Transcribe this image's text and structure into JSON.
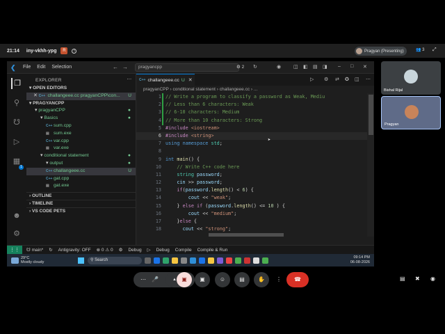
{
  "meet": {
    "time": "21:14",
    "code": "iny-vkhh-ypg",
    "badge": "R",
    "info_icon": "i",
    "presenter": "Pragyan (Presenting)",
    "participant_count": "3"
  },
  "vscode": {
    "menu": [
      "File",
      "Edit",
      "Selection"
    ],
    "command_center": "pragyancpp",
    "copilot_count": "2",
    "explorer_title": "EXPLORER",
    "open_editors_label": "OPEN EDITORS",
    "open_editor_file": "challangeee.cc pragyanCPP\\con...",
    "open_editor_status": "U",
    "root_folder": "PRAGYANCPP",
    "tree": [
      {
        "label": "pragyanCPP",
        "kind": "folder",
        "depth": 1
      },
      {
        "label": "Basics",
        "kind": "folder",
        "depth": 2
      },
      {
        "label": "sum.cpp",
        "kind": "file",
        "depth": 3
      },
      {
        "label": "sum.exe",
        "kind": "exe",
        "depth": 3
      },
      {
        "label": "var.cpp",
        "kind": "file",
        "depth": 3
      },
      {
        "label": "var.exe",
        "kind": "exe",
        "depth": 3
      },
      {
        "label": "conditional statement",
        "kind": "folder",
        "depth": 2
      },
      {
        "label": "output",
        "kind": "folder",
        "depth": 3
      },
      {
        "label": "challangeee.cc",
        "kind": "file",
        "depth": 3,
        "status": "U"
      },
      {
        "label": "gat.cpp",
        "kind": "file",
        "depth": 3
      },
      {
        "label": "gat.exe",
        "kind": "exe",
        "depth": 3
      }
    ],
    "outline_label": "OUTLINE",
    "timeline_label": "TIMELINE",
    "code_pets_label": "VS CODE PETS",
    "tab_name": "challangeee.cc",
    "tab_status": "U",
    "breadcrumb": "pragyanCPP › conditional statement › challangeee.cc › ...",
    "code_lines": [
      {
        "n": "1",
        "html": "<span class='cm'>// Write a program to classify a password as Weak, Mediu</span>"
      },
      {
        "n": "2",
        "html": "<span class='cm'>// Less than 6 characters: Weak</span>"
      },
      {
        "n": "3",
        "html": "<span class='cm'>// 6-10 characters: Medium</span>"
      },
      {
        "n": "4",
        "html": "<span class='cm'>// More than 10 characters: Strong</span>"
      },
      {
        "n": "5",
        "html": "<span class='pp'>#include</span> <span class='st'>&lt;iostream&gt;</span>"
      },
      {
        "n": "6",
        "html": "<span class='pp'>#include</span> <span class='st'>&lt;string&gt;</span>",
        "current": true
      },
      {
        "n": "7",
        "html": "<span class='kw'>using</span> <span class='kw'>namespace</span> <span class='ty'>std</span>;"
      },
      {
        "n": "8",
        "html": ""
      },
      {
        "n": "9",
        "html": "<span class='kw'>int</span> <span class='fn'>main</span>() {"
      },
      {
        "n": "10",
        "html": "    <span class='cm'>// Write C++ code here</span>"
      },
      {
        "n": "11",
        "html": "    <span class='ty'>string</span> <span class='va'>password</span>;"
      },
      {
        "n": "12",
        "html": "    <span class='va'>cin</span> &gt;&gt; <span class='va'>password</span>;"
      },
      {
        "n": "13",
        "html": "    <span class='pp'>if</span>(<span class='va'>password</span>.<span class='fn'>length</span>() &lt; <span class='nu'>6</span>) {"
      },
      {
        "n": "14",
        "html": "        <span class='va'>cout</span> &lt;&lt; <span class='st'>\"weak\"</span>;"
      },
      {
        "n": "15",
        "html": "    } <span class='pp'>else</span> <span class='pp'>if</span> (<span class='va'>password</span>.<span class='fn'>length</span>() &lt;= <span class='nu'>10</span> ) {"
      },
      {
        "n": "16",
        "html": "        <span class='va'>cout</span> &lt;&lt; <span class='st'>\"medium\"</span>;"
      },
      {
        "n": "17",
        "html": "    }<span class='pp'>else</span> {"
      },
      {
        "n": "18",
        "html": "      <span class='va'>cout</span> &lt;&lt; <span class='st'>\"strong\"</span>;"
      }
    ],
    "status": {
      "branch": "main*",
      "antigravity": "Antigravity: OFF",
      "errors": "0",
      "warnings": "0",
      "debug1": "Debug",
      "debug2": "Debug",
      "compile": "Compile",
      "compile_run": "Compile & Run"
    }
  },
  "taskbar": {
    "temp": "29°C",
    "weather": "Mostly cloudy",
    "search": "Search",
    "clock_time": "09:14 PM",
    "clock_date": "06-08-2026"
  },
  "tiles": [
    {
      "name": "Bishal Rijal"
    },
    {
      "name": "Pragyan"
    }
  ],
  "colors": {
    "vscode_bg": "#1e1e1e",
    "accent": "#0078d4",
    "end_call": "#d93025"
  }
}
